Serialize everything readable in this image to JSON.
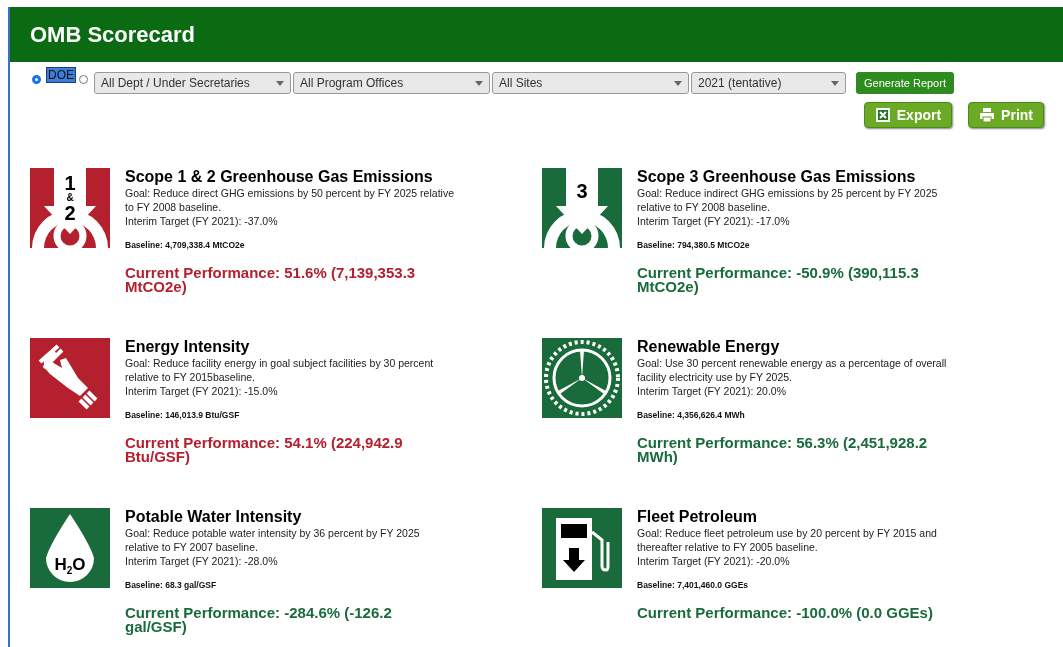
{
  "header": {
    "title": "OMB Scorecard"
  },
  "scope_radios": [
    {
      "label": "DOE",
      "selected": true
    },
    {
      "selected": false
    }
  ],
  "filters": [
    {
      "value": "All Dept / Under Secretaries"
    },
    {
      "value": "All Program Offices"
    },
    {
      "value": "All Sites"
    },
    {
      "value": "2021 (tentative)"
    }
  ],
  "generate_button": "Generate Report",
  "actions": [
    {
      "kind": "export",
      "label": "Export"
    },
    {
      "kind": "print",
      "label": "Print"
    }
  ],
  "metrics": [
    {
      "kind": "scope12",
      "icon_text": [
        "1",
        "&",
        "2"
      ],
      "color": "#b5202e",
      "title": "Scope 1 & 2 Greenhouse Gas Emissions",
      "goal": "Goal: Reduce direct GHG emissions by 50 percent by FY 2025 relative to FY 2008 baseline.",
      "interim": "Interim Target (FY 2021): -37.0%",
      "baseline": "Baseline: 4,709,338.4 MtCO2e",
      "performance": "Current Performance: 51.6% (7,139,353.3 MtCO2e)"
    },
    {
      "kind": "scope3",
      "icon_text": [
        "3"
      ],
      "color": "#1a6b3c",
      "title": "Scope 3 Greenhouse Gas Emissions",
      "goal": "Goal: Reduce indirect GHG emissions by 25 percent by FY 2025 relative to FY 2008 baseline.",
      "interim": "Interim Target (FY 2021): -17.0%",
      "baseline": "Baseline: 794,380.5 MtCO2e",
      "performance": "Current Performance: -50.9% (390,115.3 MtCO2e)"
    },
    {
      "kind": "bulb",
      "color": "#b5202e",
      "title": "Energy Intensity",
      "goal": "Goal: Reduce facility energy in goal subject facilities by 30 percent relative to FY 2015baseline.",
      "interim": "Interim Target (FY 2021): -15.0%",
      "baseline": "Baseline: 146,013.9 Btu/GSF",
      "performance": "Current Performance: 54.1% (224,942.9 Btu/GSF)"
    },
    {
      "kind": "turbine",
      "color": "#1a6b3c",
      "title": "Renewable Energy",
      "goal": "Goal: Use 30 percent renewable energy as a percentage of overall facility electricity use by FY 2025.",
      "interim": "Interim Target (FY 2021): 20.0%",
      "baseline": "Baseline: 4,356,626.4 MWh",
      "performance": "Current Performance: 56.3% (2,451,928.2 MWh)"
    },
    {
      "kind": "water",
      "icon_text": [
        "H",
        "2",
        "O"
      ],
      "color": "#1a6b3c",
      "title": "Potable Water Intensity",
      "goal": "Goal: Reduce potable water intensity by 36 percent by FY 2025 relative to FY 2007 baseline.",
      "interim": "Interim Target (FY 2021): -28.0%",
      "baseline": "Baseline: 68.3 gal/GSF",
      "performance": "Current Performance: -284.6% (-126.2 gal/GSF)"
    },
    {
      "kind": "fuel",
      "color": "#1a6b3c",
      "title": "Fleet Petroleum",
      "goal": "Goal: Reduce fleet petroleum use by 20 percent by FY 2015 and thereafter relative to FY 2005 baseline.",
      "interim": "Interim Target (FY 2021): -20.0%",
      "baseline": "Baseline: 7,401,460.0 GGEs",
      "performance": "Current Performance: -100.0% (0.0 GGEs)"
    }
  ]
}
